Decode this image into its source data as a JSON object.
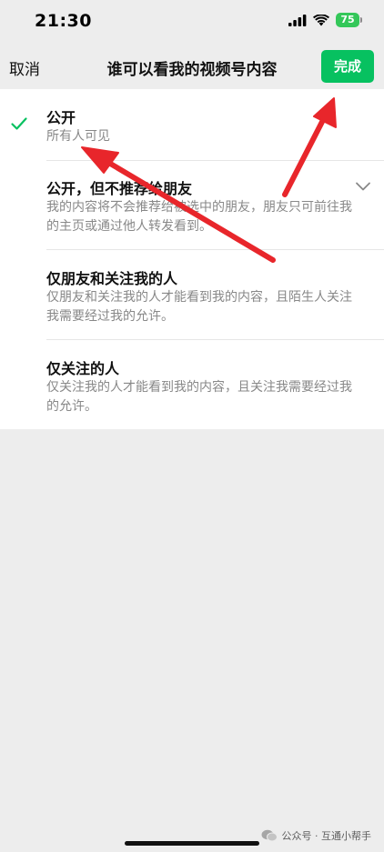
{
  "status_bar": {
    "time": "21:30",
    "battery": "75"
  },
  "nav": {
    "cancel_label": "取消",
    "title": "谁可以看我的视频号内容",
    "done_label": "完成"
  },
  "options": [
    {
      "title": "公开",
      "description": "所有人可见",
      "selected": true
    },
    {
      "title": "公开，但不推荐给朋友",
      "description": "我的内容将不会推荐给被选中的朋友，朋友只可前往我的主页或通过他人转发看到。",
      "expandable": true
    },
    {
      "title": "仅朋友和关注我的人",
      "description": "仅朋友和关注我的人才能看到我的内容，且陌生人关注我需要经过我的允许。"
    },
    {
      "title": "仅关注的人",
      "description": "仅关注我的人才能看到我的内容，且关注我需要经过我的允许。"
    }
  ],
  "watermark": "公众号 · 互通小帮手",
  "colors": {
    "accent": "#07c160",
    "background": "#ededed",
    "annotation_arrow": "#e8262b",
    "battery": "#34c759"
  },
  "icons": [
    "signal-icon",
    "wifi-icon",
    "battery-icon",
    "check-icon",
    "chevron-down-icon",
    "wechat-logo-icon"
  ]
}
